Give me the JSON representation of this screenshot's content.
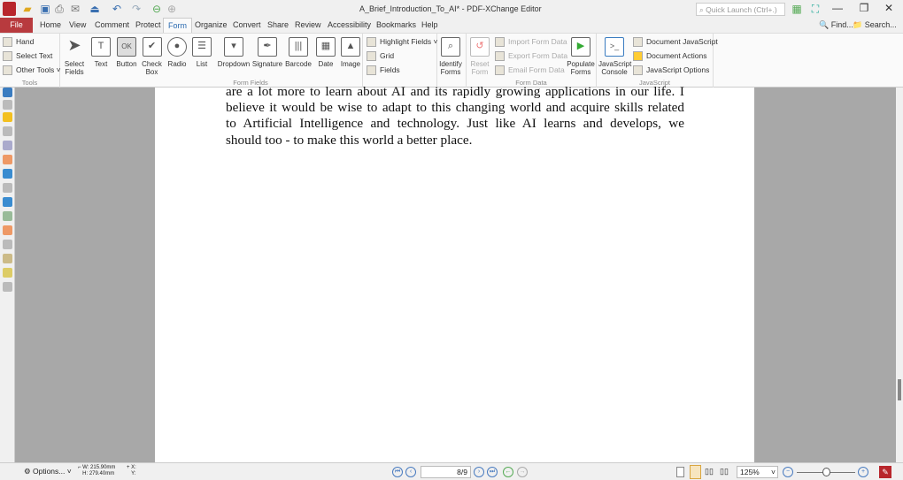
{
  "window": {
    "title": "A_Brief_Introduction_To_AI* - PDF-XChange Editor",
    "quick_launch_placeholder": "Quick Launch (Ctrl+.)",
    "minimize": "—",
    "maximize": "❐",
    "close": "✕"
  },
  "menu": {
    "tabs": [
      "File",
      "Home",
      "View",
      "Comment",
      "Protect",
      "Form",
      "Organize",
      "Convert",
      "Share",
      "Review",
      "Accessibility",
      "Bookmarks",
      "Help"
    ],
    "find": "Find...",
    "search": "Search..."
  },
  "ribbon": {
    "tools": {
      "label": "Tools",
      "items": [
        "Hand",
        "Select Text",
        "Other Tools"
      ]
    },
    "form_fields": {
      "label": "Form Fields",
      "select": "Select Fields",
      "buttons": [
        "Text",
        "Button",
        "Check Box",
        "Radio",
        "List",
        "Dropdown",
        "Signature",
        "Barcode",
        "Date",
        "Image"
      ],
      "small": [
        "Highlight Fields",
        "Grid",
        "Fields"
      ]
    },
    "identify": "Identify Forms",
    "form_data": {
      "label": "Form Data",
      "reset": "Reset Form",
      "small": [
        "Import Form Data",
        "Export Form Data",
        "Email Form Data"
      ],
      "populate": "Populate Forms"
    },
    "javascript": {
      "label": "JavaScript",
      "console": "JavaScript Console",
      "small": [
        "Document JavaScript",
        "Document Actions",
        "JavaScript Options"
      ]
    }
  },
  "document": {
    "lines": [
      "are a lot more to learn about AI and its rapidly growing applications in our life. I",
      "believe it would be wise to adapt to this changing world and acquire skills related",
      "to Artificial Intelligence and technology. Just like AI learns and develops, we",
      "should too - to make this world a better place."
    ]
  },
  "status": {
    "options": "Options...",
    "width": "W: 215.90mm",
    "height": "H: 279.40mm",
    "x": "X:",
    "y": "Y:",
    "page": "8/9",
    "zoom": "125%"
  }
}
